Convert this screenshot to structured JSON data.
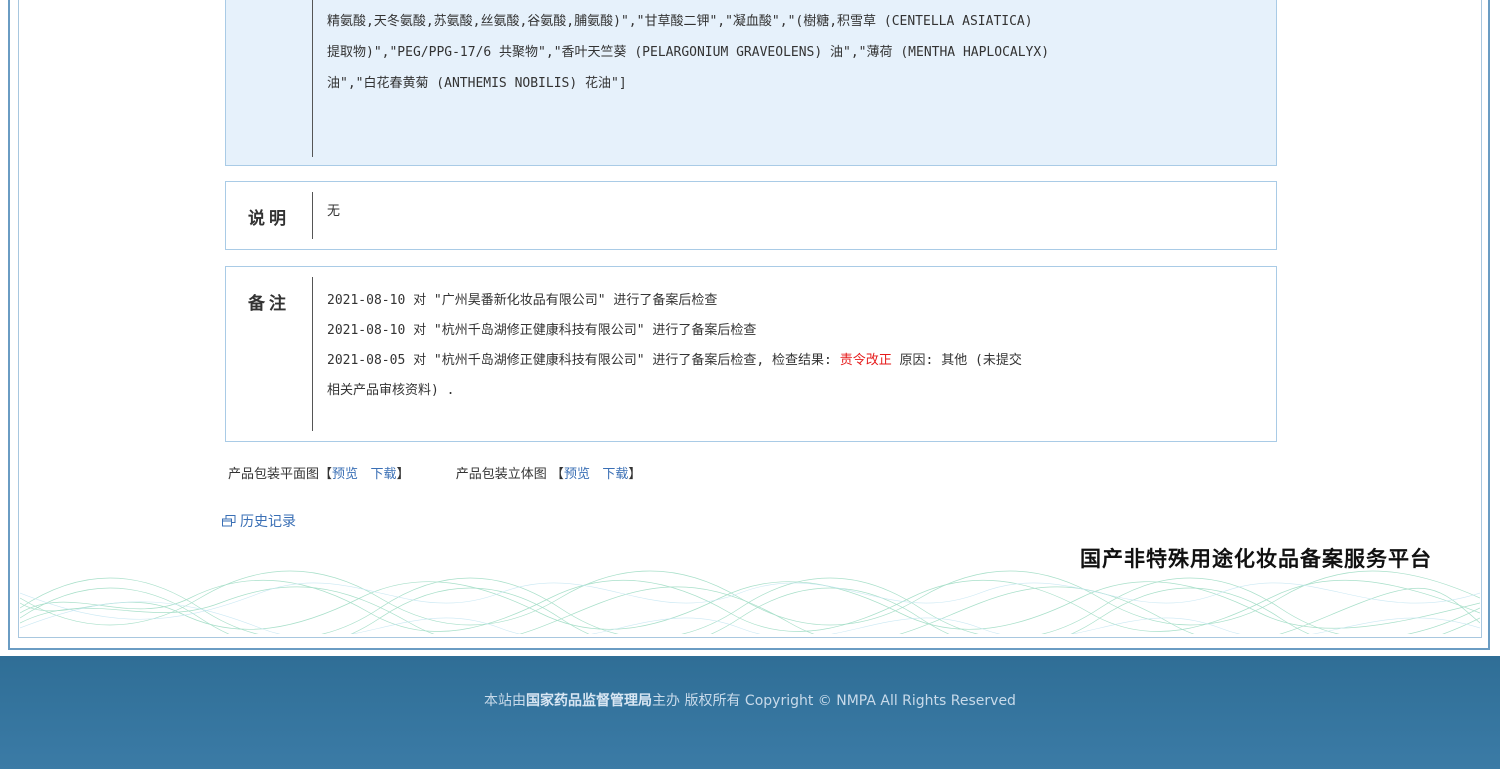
{
  "ingredients": {
    "lines": [
      "精氨酸,天冬氨酸,苏氨酸,丝氨酸,谷氨酸,脯氨酸)\",\"甘草酸二钾\",\"凝血酸\",\"(樹糖,积雪草 (CENTELLA ASIATICA)",
      "提取物)\",\"PEG/PPG-17/6 共聚物\",\"香叶天竺葵 (PELARGONIUM GRAVEOLENS) 油\",\"薄荷 (MENTHA HAPLOCALYX)",
      "油\",\"白花春黄菊 (ANTHEMIS NOBILIS) 花油\"]"
    ]
  },
  "description": {
    "label": "说明",
    "value": "无"
  },
  "notes": {
    "label": "备注",
    "line1": "2021-08-10 对 \"广州昊番新化妆品有限公司\" 进行了备案后检查",
    "line2": "2021-08-10 对 \"杭州千岛湖修正健康科技有限公司\" 进行了备案后检查",
    "line3_prefix": "2021-08-05 对 \"杭州千岛湖修正健康科技有限公司\" 进行了备案后检查, 检查结果: ",
    "line3_result": "责令改正",
    "line3_suffix": " 原因: 其他 (未提交",
    "line4": "相关产品审核资料) ."
  },
  "downloads": {
    "flat_label": "产品包装平面图",
    "solid_label": "产品包装立体图",
    "open_bracket": "【",
    "close_bracket": "】",
    "preview": "预览",
    "download": "下载"
  },
  "history": {
    "label": "历史记录",
    "icon": "window-icon"
  },
  "platform_title": "国产非特殊用途化妆品备案服务平台",
  "footer": {
    "prefix": "本站由",
    "org": "国家药品监督管理局",
    "suffix": "主办 版权所有 Copyright © NMPA All Rights Reserved"
  },
  "colors": {
    "accent_blue": "#3a6fb5",
    "footer_bg": "#356f9c",
    "red": "#e61b1b",
    "box_border": "#a9cbe6",
    "ingredients_bg": "#e6f1fb"
  }
}
